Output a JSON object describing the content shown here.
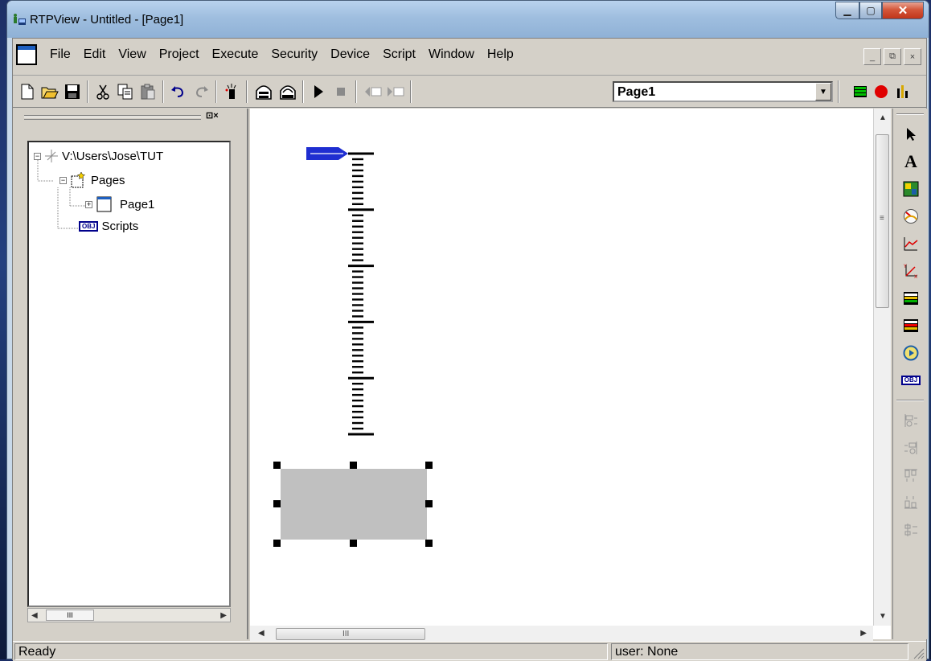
{
  "window": {
    "title": "RTPView  -  Untitled - [Page1]",
    "caption_min": "▁",
    "caption_max": "▢",
    "caption_close": "✕"
  },
  "menu": {
    "items": [
      "File",
      "Edit",
      "View",
      "Project",
      "Execute",
      "Security",
      "Device",
      "Script",
      "Window",
      "Help"
    ],
    "mdi_min": "_",
    "mdi_restore": "⧉",
    "mdi_close": "×"
  },
  "toolbar": {
    "page_combo_value": "Page1"
  },
  "tree": {
    "pane_ctrls": "⊡×",
    "root": "V:\\Users\\Jose\\TUT",
    "pages": "Pages",
    "page1": "Page1",
    "scripts": "Scripts",
    "scripts_badge": "OBJ",
    "hscroll_thumb": "III"
  },
  "canvas": {
    "hscroll_thumb": "III",
    "vscroll_thumb": "≡"
  },
  "palette": {
    "obj_badge": "OBJ"
  },
  "status": {
    "left": "Ready",
    "right": "user: None"
  },
  "colors": {
    "pointer_blue": "#1f2ed1",
    "selection_fill": "#c0c0c0",
    "status_red": "#e00000",
    "status_green": "#00a000"
  },
  "icons": [
    "new-icon",
    "open-icon",
    "save-icon",
    "cut-icon",
    "copy-icon",
    "paste-icon",
    "undo-icon",
    "redo-icon",
    "magic-icon",
    "build-icon",
    "build-all-icon",
    "run-icon",
    "stop-icon",
    "prev-page-icon",
    "next-page-icon",
    "green-bars-icon",
    "record-icon",
    "bar-chart-icon"
  ]
}
